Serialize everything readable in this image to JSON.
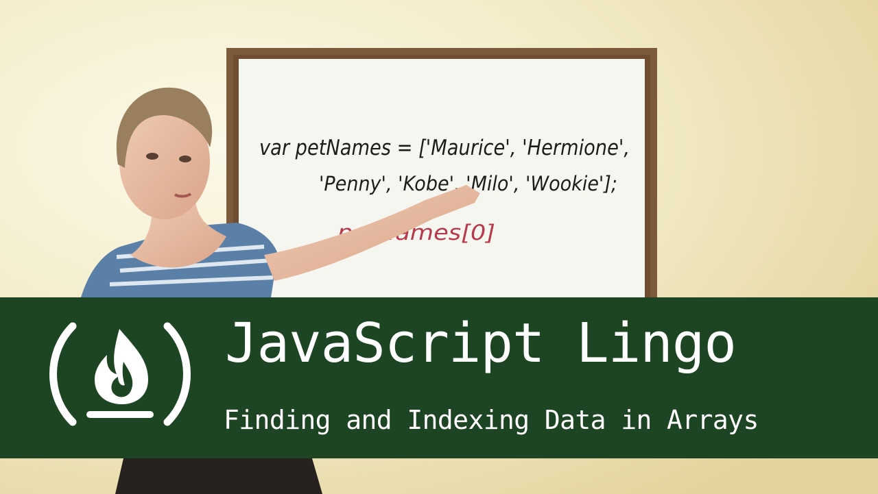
{
  "banner": {
    "title": "JavaScript Lingo",
    "subtitle": "Finding and Indexing Data in Arrays",
    "color": "#1d4423"
  },
  "logo": {
    "icon": "freecodecamp-flame-icon"
  },
  "whiteboard": {
    "line1": "var petNames = ['Maurice', 'Hermione',",
    "line2": "'Penny', 'Kobe', 'Milo', 'Wookie'];",
    "line3": "petNames[0]"
  }
}
